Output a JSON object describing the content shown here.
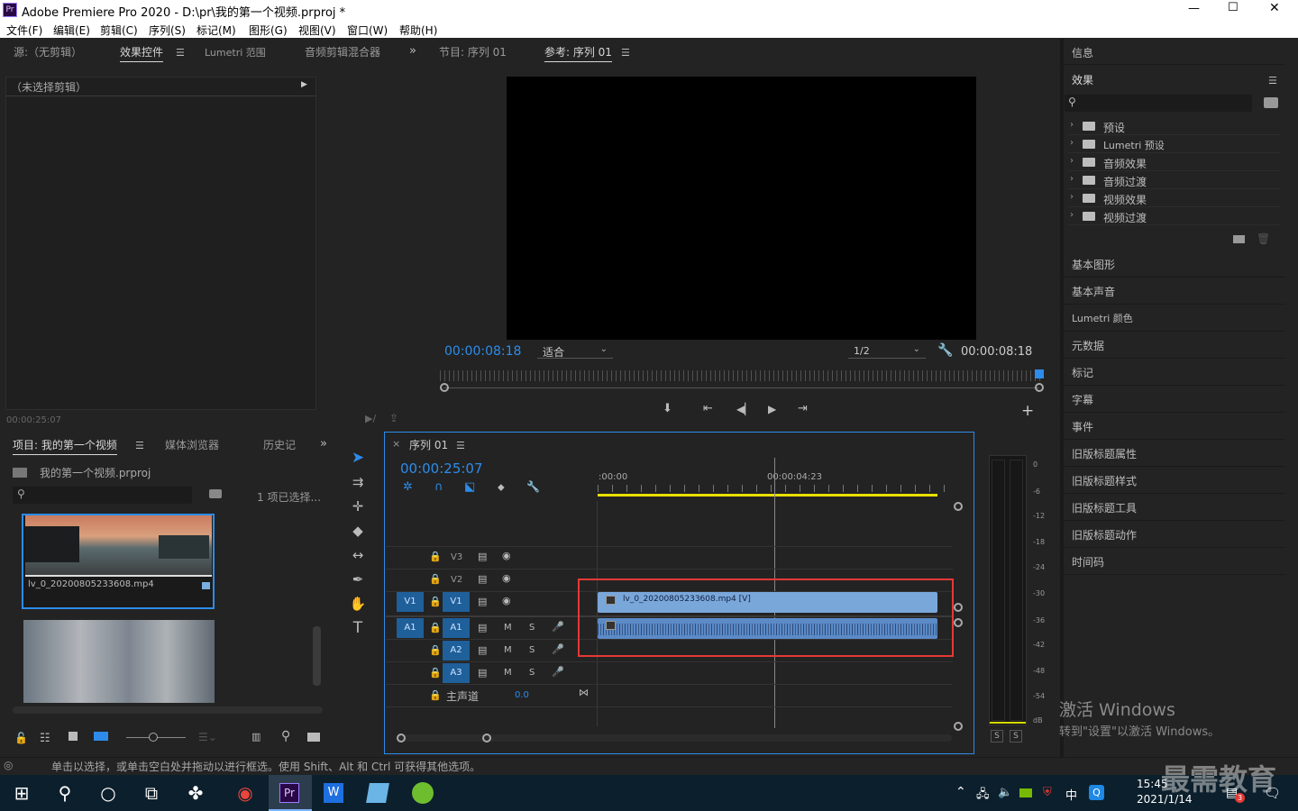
{
  "app": {
    "title": "Adobe Premiere Pro 2020 - D:\\pr\\我的第一个视频.prproj *",
    "icon_text": "Pr",
    "window_controls": [
      "—",
      "☐",
      "✕"
    ]
  },
  "menu": [
    "文件(F)",
    "编辑(E)",
    "剪辑(C)",
    "序列(S)",
    "标记(M)",
    "图形(G)",
    "视图(V)",
    "窗口(W)",
    "帮助(H)"
  ],
  "source_panel": {
    "tabs": [
      "源:（无剪辑）",
      "效果控件",
      "Lumetri 范围",
      "音频剪辑混合器"
    ],
    "no_clip": "（未选择剪辑）",
    "timecode": "00:00:25:07"
  },
  "program_panel": {
    "tabs": [
      "节目: 序列 01",
      "参考: 序列 01"
    ],
    "timecode_left": "00:00:08:18",
    "fit": "适合",
    "resolution": "1/2",
    "timecode_right": "00:00:08:18"
  },
  "project_panel": {
    "tabs": [
      "项目: 我的第一个视频",
      "媒体浏览器",
      "历史记"
    ],
    "file": "我的第一个视频.prproj",
    "selection": "1 项已选择...",
    "clip1_name": "lv_0_20200805233608.mp4"
  },
  "timeline": {
    "close": "×",
    "tab": "序列 01",
    "timecode": "00:00:25:07",
    "ruler": [
      ":00:00",
      "00:00:04:23"
    ],
    "video_tracks": [
      "V3",
      "V2",
      "V1"
    ],
    "audio_tracks": [
      "A1",
      "A2",
      "A3"
    ],
    "src_v": "V1",
    "src_a": "A1",
    "m": "M",
    "s": "S",
    "master_label": "主声道",
    "master_value": "0.0",
    "video_clip": "lv_0_20200805233608.mp4 [V]"
  },
  "meter": {
    "labels": [
      "0",
      "-6",
      "-12",
      "-18",
      "-24",
      "-30",
      "-36",
      "-42",
      "-48",
      "-54",
      "dB"
    ],
    "solo": [
      "S",
      "S"
    ]
  },
  "right_panel": {
    "info": "信息",
    "effects": "效果",
    "effects_tree": [
      "预设",
      "Lumetri 预设",
      "音频效果",
      "音频过渡",
      "视频效果",
      "视频过渡"
    ],
    "items": [
      "基本图形",
      "基本声音",
      "Lumetri 颜色",
      "元数据",
      "标记",
      "字幕",
      "事件",
      "旧版标题属性",
      "旧版标题样式",
      "旧版标题工具",
      "旧版标题动作",
      "时间码"
    ]
  },
  "status": "单击以选择，或单击空白处并拖动以进行框选。使用 Shift、Alt 和 Ctrl 可获得其他选项。",
  "watermark": {
    "activate_title": "激活 Windows",
    "activate_sub": "转到\"设置\"以激活 Windows。",
    "brand": "最需教育"
  },
  "taskbar": {
    "time": "15:45",
    "date": "2021/1/14",
    "ime": "中",
    "notif_count": "3"
  }
}
